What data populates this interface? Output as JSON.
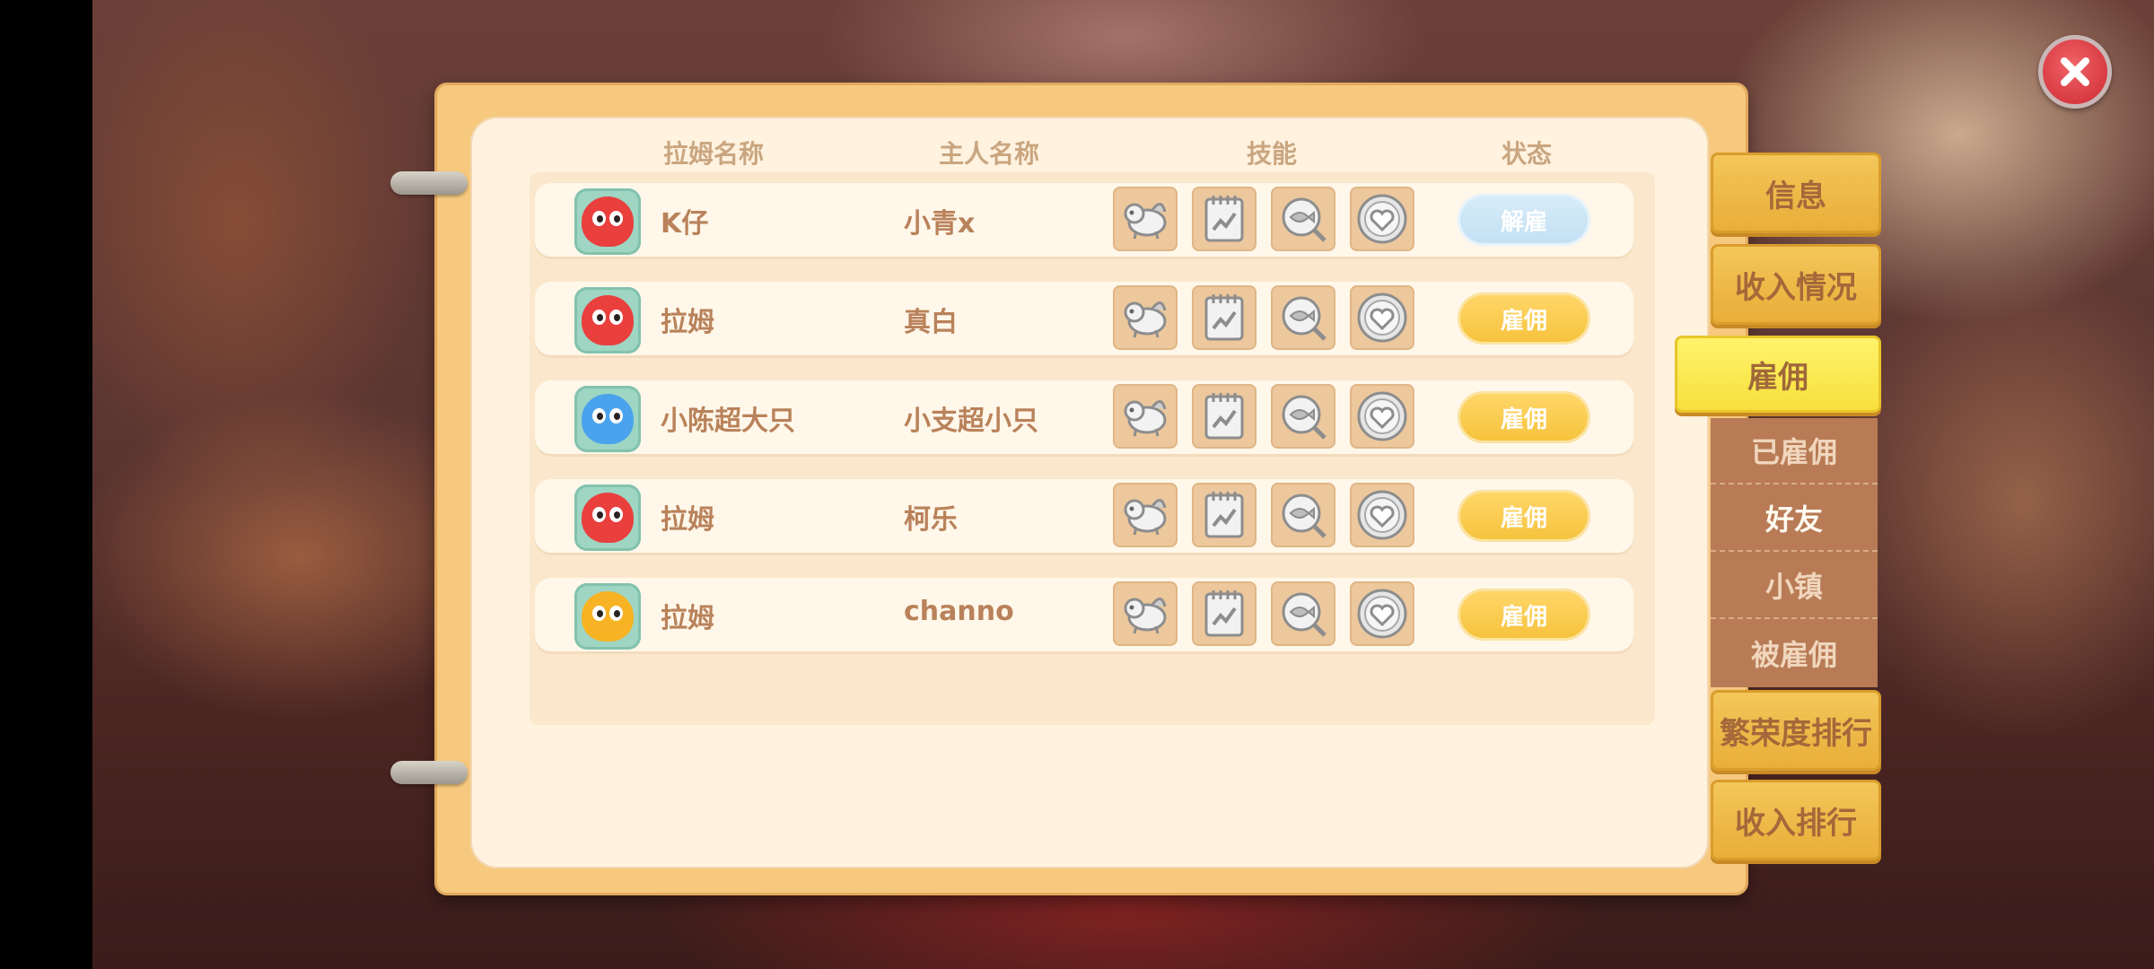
{
  "columns": {
    "pet_name": "拉姆名称",
    "owner_name": "主人名称",
    "skills": "技能",
    "status": "状态"
  },
  "rows": [
    {
      "pet_name": "K仔",
      "owner_name": "小青x",
      "action": "解雇",
      "avatar_color": "#e9403e"
    },
    {
      "pet_name": "拉姆",
      "owner_name": "真白",
      "action": "雇佣",
      "avatar_color": "#e9403e"
    },
    {
      "pet_name": "小陈超大只",
      "owner_name": "小支超小只",
      "action": "雇佣",
      "avatar_color": "#4aa3ec"
    },
    {
      "pet_name": "拉姆",
      "owner_name": "柯乐",
      "action": "雇佣",
      "avatar_color": "#e9403e"
    },
    {
      "pet_name": "拉姆",
      "owner_name": "channo",
      "action": "雇佣",
      "avatar_color": "#f7b324"
    }
  ],
  "skill_icons": [
    "dog-skill-icon",
    "chart-notebook-skill-icon",
    "fish-magnifier-skill-icon",
    "heart-skill-icon"
  ],
  "tabs": {
    "info": "信息",
    "income": "收入情况",
    "hire": "雇佣",
    "prosperity_rank": "繁荣度排行",
    "income_rank": "收入排行"
  },
  "subtabs": [
    "已雇佣",
    "好友",
    "小镇",
    "被雇佣"
  ],
  "active_tab": "雇佣",
  "active_subtab": "好友",
  "colors": {
    "hire_button": "#f6c23b",
    "fire_button": "#c2e0f3",
    "tab": "#e8ae38",
    "active_tab": "#f7e03c",
    "close_button": "#d83a42"
  }
}
